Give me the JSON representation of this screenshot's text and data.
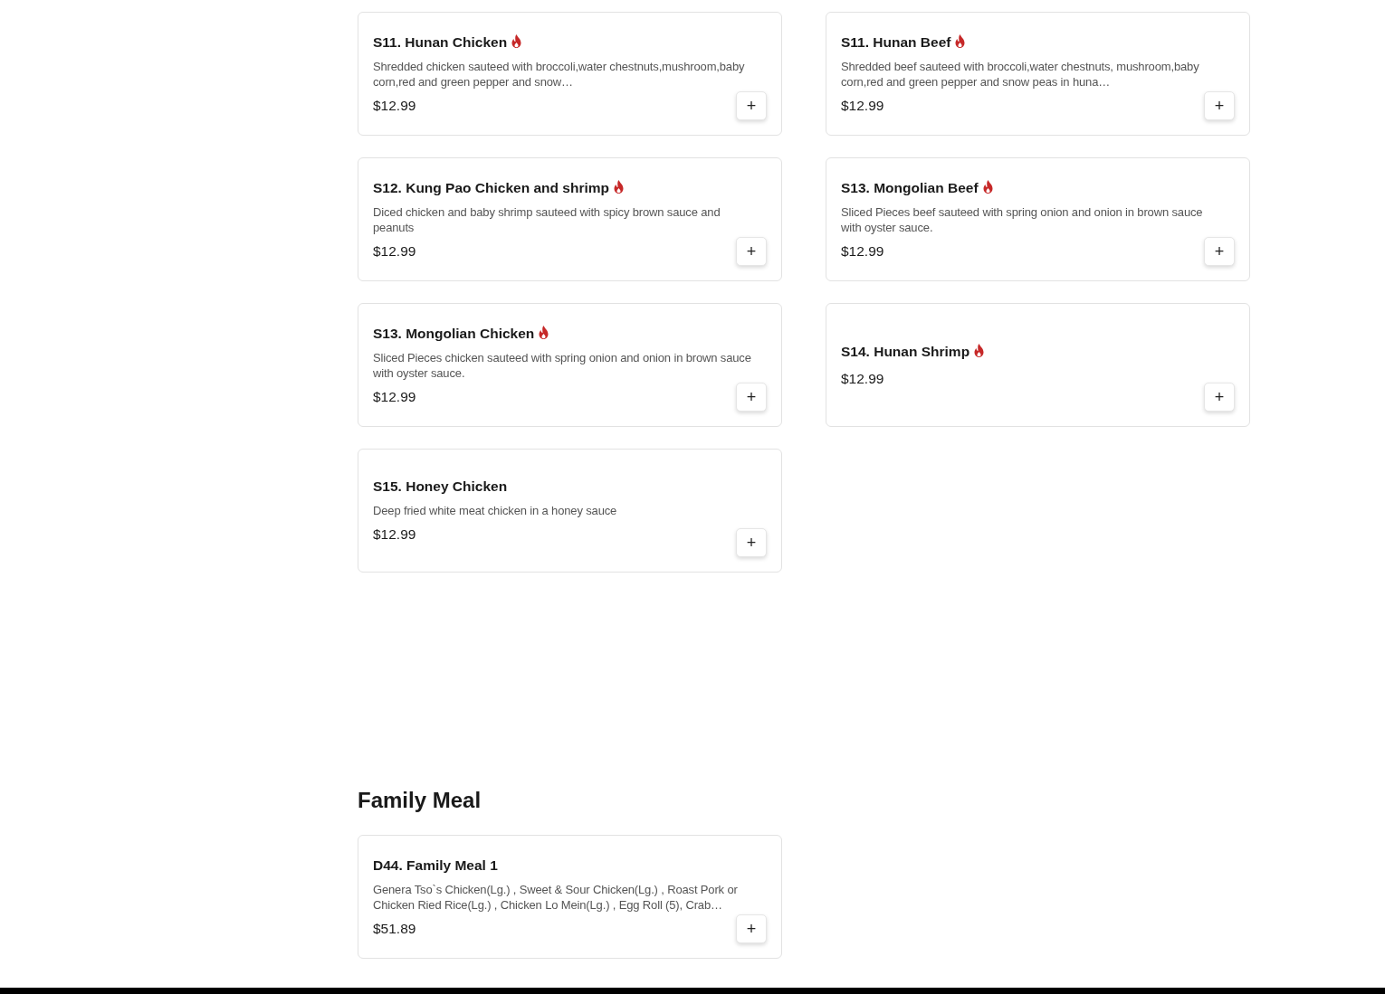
{
  "sections": [
    {
      "items": [
        {
          "name": "S11. Hunan Chicken",
          "spicy": true,
          "description": "Shredded chicken sauteed with broccoli,water chestnuts,mushroom,baby corn,red and green pepper and snow…",
          "price": "$12.99",
          "add": "+"
        },
        {
          "name": "S11. Hunan Beef",
          "spicy": true,
          "description": "Shredded beef sauteed with broccoli,water chestnuts, mushroom,baby corn,red and green pepper and snow peas in huna…",
          "price": "$12.99",
          "add": "+"
        },
        {
          "name": "S12. Kung Pao Chicken and shrimp",
          "spicy": true,
          "description": "Diced chicken and baby shrimp sauteed with spicy brown sauce and peanuts",
          "price": "$12.99",
          "add": "+"
        },
        {
          "name": "S13. Mongolian Beef",
          "spicy": true,
          "description": "Sliced Pieces beef sauteed with spring onion and onion in brown sauce with oyster sauce.",
          "price": "$12.99",
          "add": "+"
        },
        {
          "name": "S13. Mongolian Chicken",
          "spicy": true,
          "description": "Sliced Pieces chicken sauteed with spring onion and onion in brown sauce with oyster sauce.",
          "price": "$12.99",
          "add": "+"
        },
        {
          "name": "S14. Hunan Shrimp",
          "spicy": true,
          "price": "$12.99",
          "add": "+"
        },
        {
          "name": "S15. Honey Chicken",
          "spicy": false,
          "description": "Deep fried white meat chicken in a honey sauce",
          "price": "$12.99",
          "add": "+"
        }
      ]
    },
    {
      "title": "Family Meal",
      "items": [
        {
          "name": "D44. Family Meal 1",
          "spicy": false,
          "description": "Genera Tso`s Chicken(Lg.) , Sweet & Sour Chicken(Lg.) , Roast Pork or Chicken Ried Rice(Lg.) , Chicken Lo Mein(Lg.) , Egg Roll (5), Crab…",
          "price": "$51.89",
          "add": "+"
        }
      ]
    }
  ]
}
